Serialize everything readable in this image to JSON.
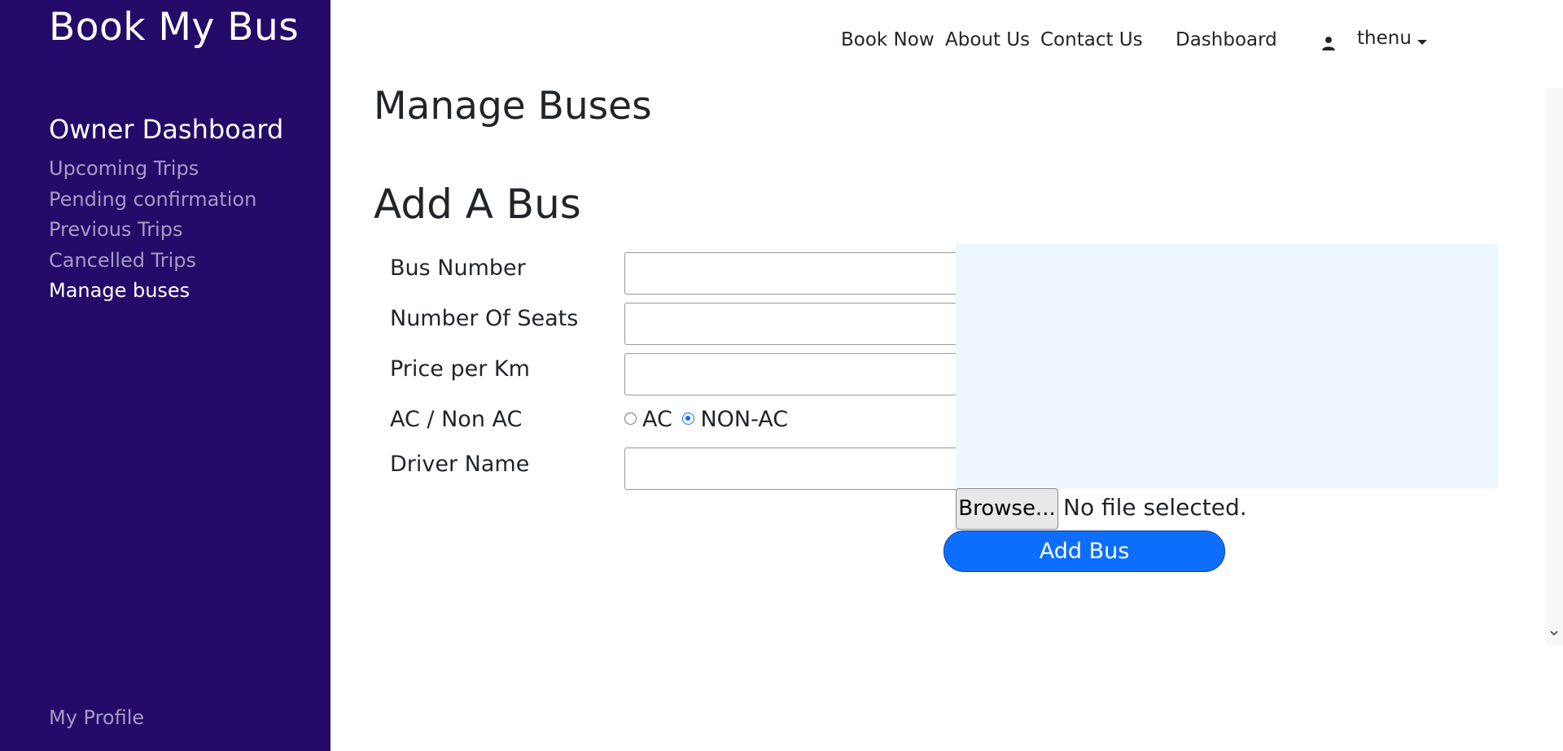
{
  "app": {
    "brand": "Book My Bus"
  },
  "sidebar": {
    "title": "Owner Dashboard",
    "items": [
      {
        "label": "Upcoming Trips",
        "active": false
      },
      {
        "label": "Pending confirmation",
        "active": false
      },
      {
        "label": "Previous Trips",
        "active": false
      },
      {
        "label": "Cancelled Trips",
        "active": false
      },
      {
        "label": "Manage buses",
        "active": true
      }
    ],
    "profile": "My Profile"
  },
  "nav": {
    "links": [
      "Book Now",
      "About Us",
      "Contact Us",
      "Dashboard"
    ],
    "user": {
      "icon": "user-icon",
      "name": "thenu"
    }
  },
  "page": {
    "title": "Manage Buses",
    "section_title": "Add A Bus"
  },
  "form": {
    "bus_number": {
      "label": "Bus Number",
      "value": ""
    },
    "seats": {
      "label": "Number Of Seats",
      "value": ""
    },
    "price": {
      "label": "Price per Km",
      "value": ""
    },
    "ac": {
      "label": "AC / Non AC",
      "options": [
        "AC",
        "NON-AC"
      ],
      "selected": "NON-AC"
    },
    "driver": {
      "label": "Driver Name",
      "value": ""
    },
    "file": {
      "button": "Browse...",
      "status": "No file selected."
    },
    "submit": "Add Bus"
  },
  "colors": {
    "sidebar_bg": "#250b69",
    "sidebar_muted": "#a49bc4",
    "primary": "#0d6efd",
    "preview_bg": "#eef6ff"
  }
}
